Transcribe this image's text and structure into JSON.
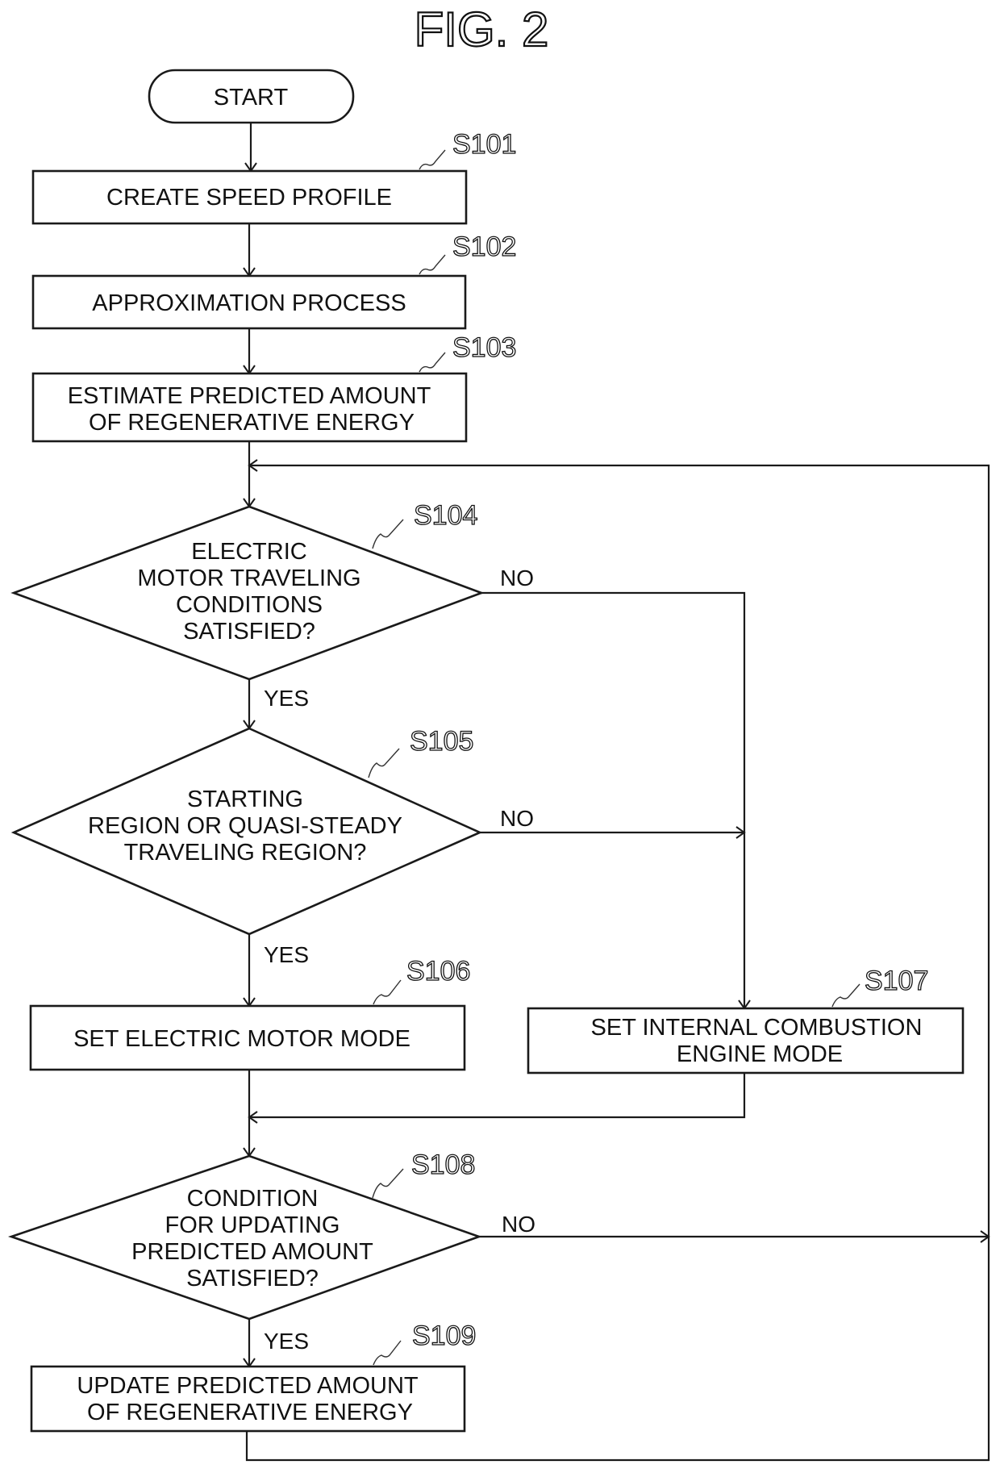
{
  "figure": {
    "title": "FIG. 2"
  },
  "nodes": {
    "start": {
      "type": "terminal",
      "text": "START"
    },
    "s101": {
      "type": "process",
      "step": "S101",
      "lines": [
        "CREATE SPEED PROFILE"
      ]
    },
    "s102": {
      "type": "process",
      "step": "S102",
      "lines": [
        "APPROXIMATION PROCESS"
      ]
    },
    "s103": {
      "type": "process",
      "step": "S103",
      "lines": [
        "ESTIMATE PREDICTED AMOUNT",
        "OF REGENERATIVE ENERGY"
      ]
    },
    "s104": {
      "type": "decision",
      "step": "S104",
      "lines": [
        "ELECTRIC",
        "MOTOR TRAVELING",
        "CONDITIONS",
        "SATISFIED?"
      ]
    },
    "s105": {
      "type": "decision",
      "step": "S105",
      "lines": [
        "STARTING",
        "REGION OR QUASI-STEADY",
        "TRAVELING REGION?"
      ]
    },
    "s106": {
      "type": "process",
      "step": "S106",
      "lines": [
        "SET ELECTRIC MOTOR MODE"
      ]
    },
    "s107": {
      "type": "process",
      "step": "S107",
      "lines": [
        "SET INTERNAL COMBUSTION",
        "ENGINE MODE"
      ]
    },
    "s108": {
      "type": "decision",
      "step": "S108",
      "lines": [
        "CONDITION",
        "FOR UPDATING",
        "PREDICTED AMOUNT",
        "SATISFIED?"
      ]
    },
    "s109": {
      "type": "process",
      "step": "S109",
      "lines": [
        "UPDATE PREDICTED AMOUNT",
        "OF REGENERATIVE ENERGY"
      ]
    }
  },
  "branch_labels": {
    "yes": "YES",
    "no": "NO"
  },
  "edges": [
    {
      "from": "start",
      "to": "s101"
    },
    {
      "from": "s101",
      "to": "s102"
    },
    {
      "from": "s102",
      "to": "s103"
    },
    {
      "from": "s103",
      "to": "s104"
    },
    {
      "from": "s104",
      "to": "s105",
      "label": "YES"
    },
    {
      "from": "s104",
      "to": "s107",
      "label": "NO"
    },
    {
      "from": "s105",
      "to": "s106",
      "label": "YES"
    },
    {
      "from": "s105",
      "to": "s107",
      "label": "NO"
    },
    {
      "from": "s106",
      "to": "s108"
    },
    {
      "from": "s107",
      "to": "s108"
    },
    {
      "from": "s108",
      "to": "s109",
      "label": "YES"
    },
    {
      "from": "s108",
      "to": "s104",
      "label": "NO"
    },
    {
      "from": "s109",
      "to": "s104"
    }
  ]
}
